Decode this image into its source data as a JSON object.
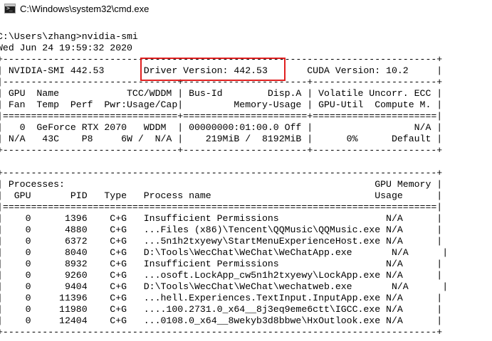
{
  "window": {
    "title": "C:\\Windows\\system32\\cmd.exe",
    "icon": "cmd-console-icon",
    "icon_glyph": ">_"
  },
  "console": {
    "lines": [
      "C:\\Users\\zhang>nvidia-smi",
      "Wed Jun 24 19:59:32 2020",
      "+-----------------------------------------------------------------------------+",
      "| NVIDIA-SMI 442.53       Driver Version: 442.53       CUDA Version: 10.2     |",
      "|-------------------------------+----------------------+----------------------+",
      "| GPU  Name            TCC/WDDM | Bus-Id        Disp.A | Volatile Uncorr. ECC |",
      "| Fan  Temp  Perf  Pwr:Usage/Cap|         Memory-Usage | GPU-Util  Compute M. |",
      "|===============================+======================+======================|",
      "|   0  GeForce RTX 2070   WDDM  | 00000000:01:00.0 Off |                  N/A |",
      "| N/A   43C    P8     6W /  N/A |    219MiB /  8192MiB |      0%      Default |",
      "+-------------------------------+----------------------+----------------------+",
      "",
      "+-----------------------------------------------------------------------------+",
      "| Processes:                                                       GPU Memory |",
      "|  GPU       PID   Type   Process name                             Usage      |",
      "|=============================================================================|",
      "|    0      1396    C+G   Insufficient Permissions                   N/A      |",
      "|    0      4880    C+G   ...Files (x86)\\Tencent\\QQMusic\\QQMusic.exe N/A      |",
      "|    0      6372    C+G   ...5n1h2txyewy\\StartMenuExperienceHost.exe N/A      |",
      "|    0      8040    C+G   D:\\Tools\\WecChat\\WeChat\\WeChatApp.exe       N/A      |",
      "|    0      8932    C+G   Insufficient Permissions                   N/A      |",
      "|    0      9260    C+G   ...osoft.LockApp_cw5n1h2txyewy\\LockApp.exe N/A      |",
      "|    0      9404    C+G   D:\\Tools\\WecChat\\WeChat\\wechatweb.exe       N/A      |",
      "|    0     11396    C+G   ...hell.Experiences.TextInput.InputApp.exe N/A      |",
      "|    0     11980    C+G   ....100.2731.0_x64__8j3eq9eme6ctt\\IGCC.exe N/A      |",
      "|    0     12404    C+G   ...0108.0_x64__8wekyb3d8bbwe\\HxOutlook.exe N/A      |",
      "+-----------------------------------------------------------------------------+"
    ]
  },
  "annotation": {
    "highlight_color": "#e02020"
  }
}
